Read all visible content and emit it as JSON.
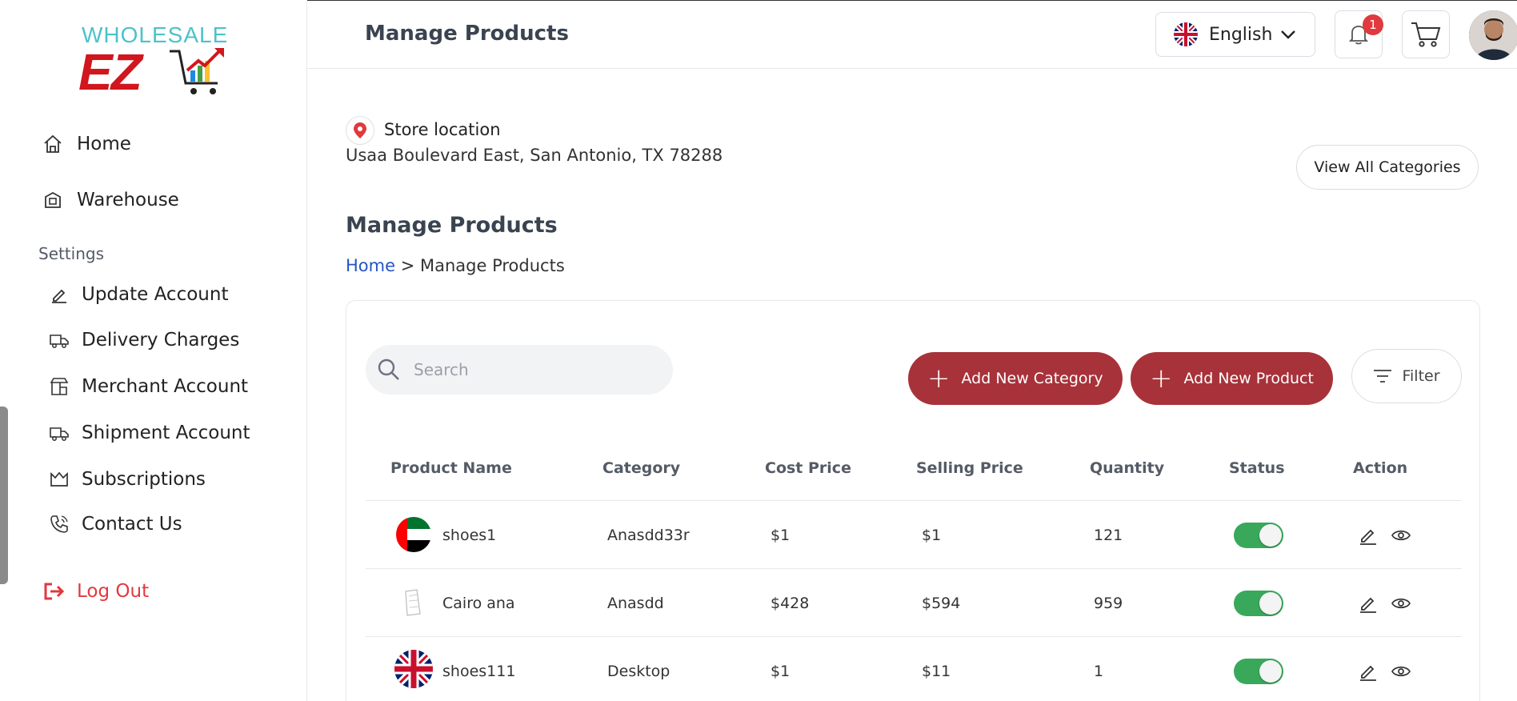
{
  "brand": {
    "logo_word": "WHOLESALE",
    "logo_mark": "EZ"
  },
  "sidebar": {
    "items": [
      {
        "label": "Home",
        "icon": "home-icon"
      },
      {
        "label": "Warehouse",
        "icon": "warehouse-icon"
      }
    ],
    "settings_label": "Settings",
    "settings_items": [
      {
        "label": "Update Account",
        "icon": "pencil-icon"
      },
      {
        "label": "Delivery Charges",
        "icon": "truck-icon"
      },
      {
        "label": "Merchant Account",
        "icon": "store-icon"
      },
      {
        "label": "Shipment Account",
        "icon": "truck-icon"
      },
      {
        "label": "Subscriptions",
        "icon": "crown-icon"
      },
      {
        "label": "Contact Us",
        "icon": "phone-icon"
      }
    ],
    "logout_label": "Log Out"
  },
  "header": {
    "title": "Manage Products",
    "language": "English",
    "notification_count": "1"
  },
  "store": {
    "label": "Store location",
    "address": "Usaa Boulevard East, San Antonio, TX 78288"
  },
  "view_all_label": "View All Categories",
  "page": {
    "title": "Manage Products",
    "breadcrumb_home": "Home",
    "breadcrumb_sep": ">",
    "breadcrumb_current": "Manage Products"
  },
  "toolbar": {
    "search_placeholder": "Search",
    "add_category_label": "Add New Category",
    "add_product_label": "Add New Product",
    "filter_label": "Filter"
  },
  "table": {
    "columns": [
      "Product Name",
      "Category",
      "Cost Price",
      "Selling Price",
      "Quantity",
      "Status",
      "Action"
    ],
    "rows": [
      {
        "name": "shoes1",
        "category": "Anasdd33r",
        "cost": "$1",
        "selling": "$1",
        "quantity": "121",
        "status_on": true,
        "image": "uae-flag"
      },
      {
        "name": "Cairo ana",
        "category": "Anasdd",
        "cost": "$428",
        "selling": "$594",
        "quantity": "959",
        "status_on": true,
        "image": "sketch"
      },
      {
        "name": "shoes111",
        "category": "Desktop",
        "cost": "$1",
        "selling": "$11",
        "quantity": "1",
        "status_on": true,
        "image": "uk-flag"
      }
    ]
  },
  "colors": {
    "primary_button": "#a8323a",
    "toggle_on": "#39a85a",
    "logout": "#e0393e",
    "link": "#2454c6"
  }
}
